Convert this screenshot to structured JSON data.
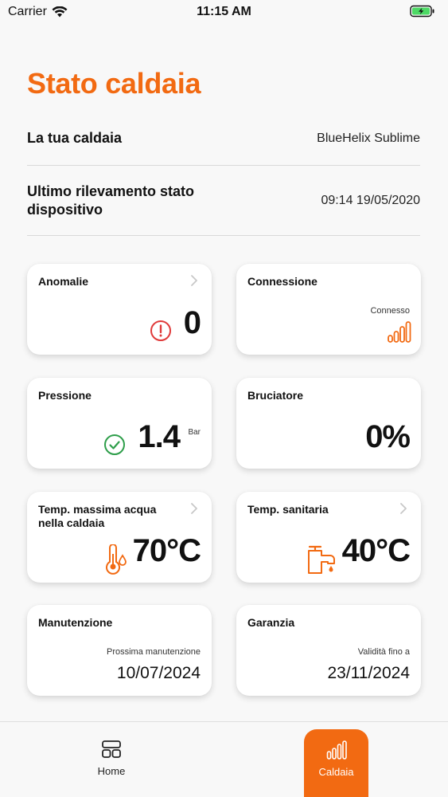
{
  "status_bar": {
    "carrier": "Carrier",
    "time": "11:15 AM"
  },
  "page": {
    "title": "Stato caldaia"
  },
  "info": {
    "boiler_label": "La tua caldaia",
    "boiler_value": "BlueHelix Sublime",
    "last_check_label": "Ultimo rilevamento stato dispositivo",
    "last_check_value": "09:14 19/05/2020"
  },
  "cards": {
    "anomalie": {
      "title": "Anomalie",
      "value": "0",
      "icon": "alert-circle-icon"
    },
    "connessione": {
      "title": "Connessione",
      "status": "Connesso",
      "icon": "signal-bars-icon"
    },
    "pressione": {
      "title": "Pressione",
      "value": "1.4",
      "unit": "Bar",
      "icon": "check-circle-icon"
    },
    "bruciatore": {
      "title": "Bruciatore",
      "value": "0%"
    },
    "temp_caldaia": {
      "title": "Temp. massima acqua nella caldaia",
      "value": "70°C",
      "icon": "thermometer-icon"
    },
    "temp_sanitaria": {
      "title": "Temp. sanitaria",
      "value": "40°C",
      "icon": "faucet-icon"
    },
    "manutenzione": {
      "title": "Manutenzione",
      "label": "Prossima manutenzione",
      "date": "10/07/2024"
    },
    "garanzia": {
      "title": "Garanzia",
      "label": "Validità fino a",
      "date": "23/11/2024"
    }
  },
  "tabbar": {
    "home_label": "Home",
    "caldaia_label": "Caldaia",
    "active": "Caldaia"
  },
  "colors": {
    "accent": "#f26a12",
    "alert": "#e03a3a",
    "ok": "#2e9e4a"
  }
}
